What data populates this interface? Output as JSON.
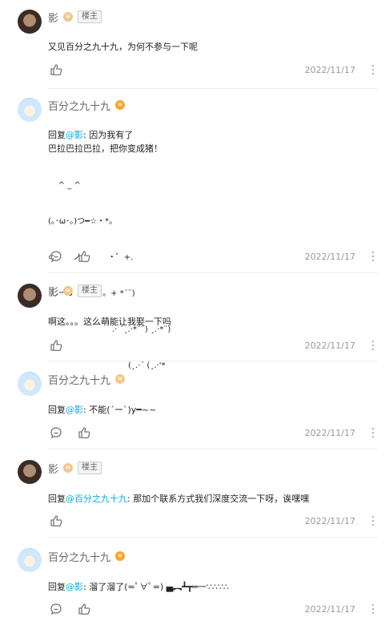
{
  "comments": [
    {
      "user": "影",
      "badge": "楼主",
      "content": "又见百分之九十九，为何不参与一下呢",
      "date": "2022/11/17",
      "actions": [
        "like-icon",
        "more-icon"
      ]
    },
    {
      "user": "百分之九十九",
      "reply_prefix": "回复",
      "reply_to": "@影",
      "reply_sep": ":",
      "content_1": " 因为我有了",
      "content_2": "巴拉巴拉巴拉，把你变成猪！",
      "art_lines": [
        "    ^ _ ^",
        "(｡･ω･｡)つ━☆・*。",
        "⊂　　 ノ 　　　・゜+.",
        " しーＪ　　　°。+ *´¨)",
        "　　　　　　　　.· ´¸.·*´¨) ¸.·*¨)",
        "　　　　　　　　　　(¸.·´ (¸.·'*"
      ],
      "date": "2022/11/17",
      "actions": [
        "reply-icon",
        "like-icon",
        "more-icon"
      ]
    },
    {
      "user": "影",
      "badge": "楼主",
      "content": "啊这。。。这么萌能让我娶一下吗",
      "date": "2022/11/17",
      "actions": [
        "like-icon",
        "more-icon"
      ]
    },
    {
      "user": "百分之九十九",
      "reply_prefix": "回复",
      "reply_to": "@影",
      "reply_sep": ":",
      "content": " 不能(´ー`)y━~~",
      "date": "2022/11/17",
      "actions": [
        "reply-icon",
        "like-icon",
        "more-icon"
      ]
    },
    {
      "user": "影",
      "badge": "楼主",
      "reply_prefix": "回复",
      "reply_to": "@百分之九十九",
      "reply_sep": ":",
      "content": " 那加个联系方式我们深度交流一下呀，诶嘿嘿",
      "date": "2022/11/17",
      "actions": [
        "like-icon",
        "more-icon"
      ]
    },
    {
      "user": "百分之九十九",
      "reply_prefix": "回复",
      "reply_to": "@影",
      "reply_sep": ":",
      "content": " 溜了溜了(=ﾟ∀ﾟ=) ▄︻┻┳═一∵∴∵∴",
      "date": "2022/11/17",
      "actions": [
        "reply-icon",
        "like-icon",
        "more-icon"
      ]
    }
  ],
  "colors": {
    "mention": "#00aeec",
    "date": "#999999",
    "badge_border": "#cccccc"
  }
}
